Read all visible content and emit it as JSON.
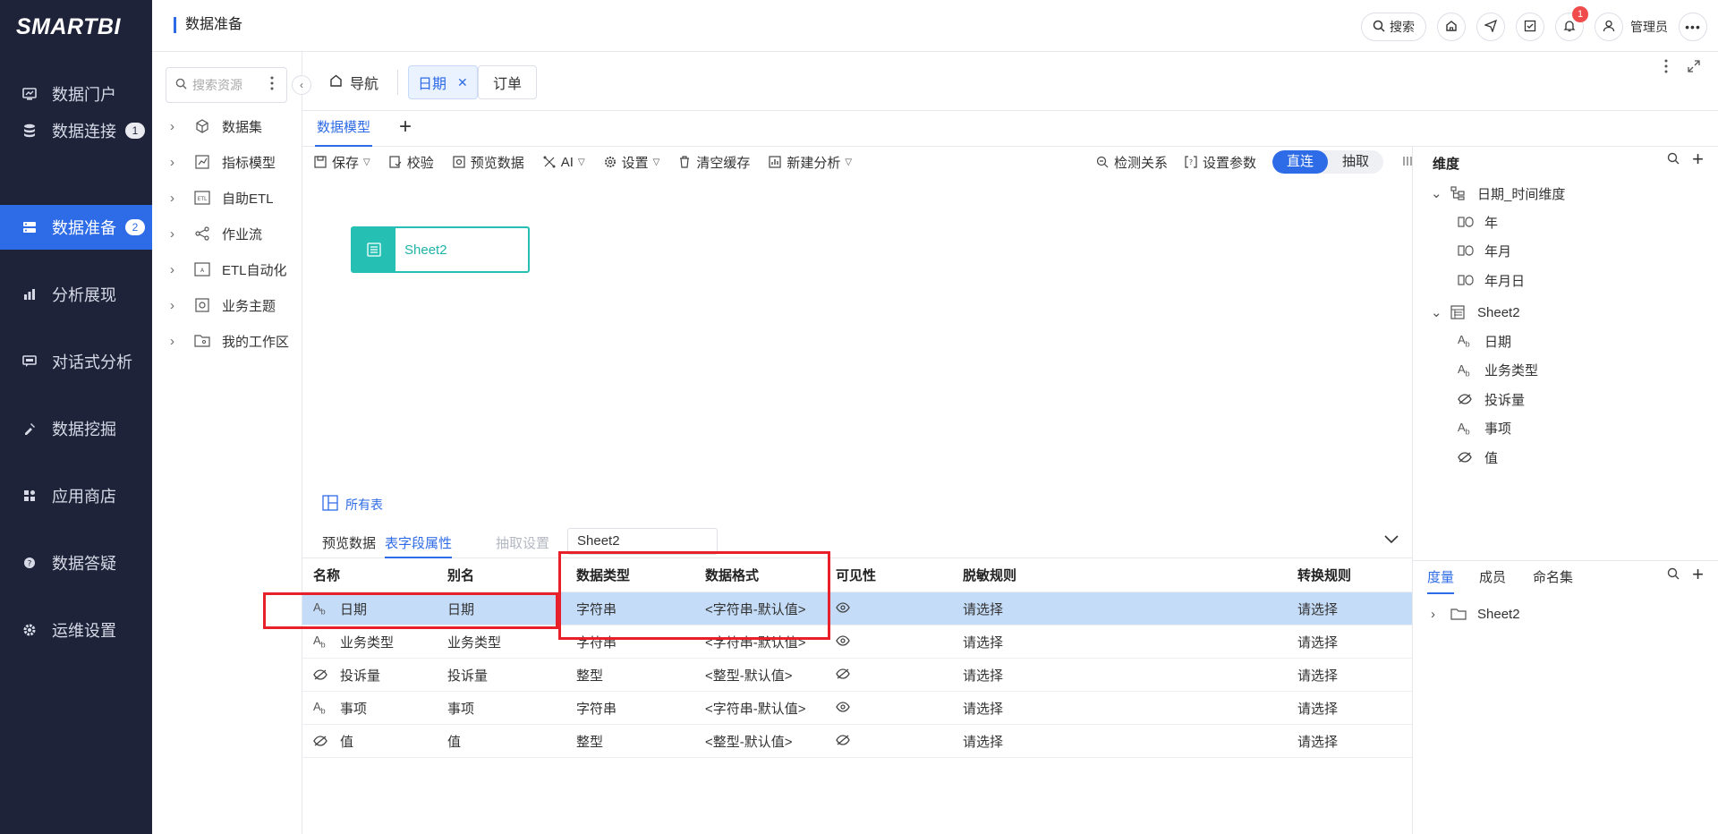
{
  "brand": "SMARTBI",
  "nav": [
    {
      "label": "数据门户",
      "icon": "portal-icon",
      "badge": ""
    },
    {
      "label": "数据连接",
      "icon": "database-icon",
      "badge": "1"
    },
    {
      "label": "数据准备",
      "icon": "server-icon",
      "badge": "2",
      "active": true
    },
    {
      "label": "分析展现",
      "icon": "bar-chart-icon",
      "badge": ""
    },
    {
      "label": "对话式分析",
      "icon": "chat-icon",
      "badge": ""
    },
    {
      "label": "数据挖掘",
      "icon": "pick-icon",
      "badge": ""
    },
    {
      "label": "应用商店",
      "icon": "apps-icon",
      "badge": ""
    },
    {
      "label": "数据答疑",
      "icon": "help-icon",
      "badge": ""
    },
    {
      "label": "运维设置",
      "icon": "gear-icon",
      "badge": ""
    }
  ],
  "header": {
    "title": "数据准备",
    "search": "搜索",
    "notif_count": "1",
    "user": "管理员"
  },
  "resources": {
    "search_placeholder": "搜索资源",
    "items": [
      "数据集",
      "指标模型",
      "自助ETL",
      "作业流",
      "ETL自动化",
      "业务主题",
      "我的工作区"
    ]
  },
  "tabs": {
    "nav": "导航",
    "items": [
      {
        "label": "日期",
        "active": true
      },
      {
        "label": "订单",
        "active": false
      }
    ]
  },
  "subtab": "数据模型",
  "toolbar": {
    "save": "保存",
    "validate": "校验",
    "preview": "预览数据",
    "ai": "AI",
    "settings": "设置",
    "clear_cache": "清空缓存",
    "new_analysis": "新建分析",
    "detect": "检测关系",
    "params": "设置参数",
    "mode_direct": "直连",
    "mode_extract": "抽取"
  },
  "canvas": {
    "node_label": "Sheet2",
    "all_tables": "所有表"
  },
  "bottom": {
    "tabs": [
      "预览数据",
      "表字段属性",
      "抽取设置"
    ],
    "sheet": "Sheet2",
    "columns": {
      "name": "名称",
      "alias": "别名",
      "type": "数据类型",
      "format": "数据格式",
      "visibility": "可见性",
      "mask": "脱敏规则",
      "convert": "转换规则"
    },
    "rows": [
      {
        "icon": "Ab",
        "name": "日期",
        "alias": "日期",
        "type": "字符串",
        "format": "<字符串-默认值>",
        "mask": "请选择",
        "convert": "请选择",
        "visible": true
      },
      {
        "icon": "Ab",
        "name": "业务类型",
        "alias": "业务类型",
        "type": "字符串",
        "format": "<字符串-默认值>",
        "mask": "请选择",
        "convert": "请选择",
        "visible": true
      },
      {
        "icon": "hidden",
        "name": "投诉量",
        "alias": "投诉量",
        "type": "整型",
        "format": "<整型-默认值>",
        "mask": "请选择",
        "convert": "请选择",
        "visible": false
      },
      {
        "icon": "Ab",
        "name": "事项",
        "alias": "事项",
        "type": "字符串",
        "format": "<字符串-默认值>",
        "mask": "请选择",
        "convert": "请选择",
        "visible": true
      },
      {
        "icon": "hidden",
        "name": "值",
        "alias": "值",
        "type": "整型",
        "format": "<整型-默认值>",
        "mask": "请选择",
        "convert": "请选择",
        "visible": false
      }
    ]
  },
  "right": {
    "title": "维度",
    "date_dim": "日期_时间维度",
    "date_levels": [
      "年",
      "年月",
      "年月日"
    ],
    "sheet": "Sheet2",
    "fields": [
      {
        "icon": "Ab",
        "label": "日期"
      },
      {
        "icon": "Ab",
        "label": "业务类型"
      },
      {
        "icon": "hidden",
        "label": "投诉量"
      },
      {
        "icon": "Ab",
        "label": "事项"
      },
      {
        "icon": "hidden",
        "label": "值"
      }
    ],
    "tabs": [
      "度量",
      "成员",
      "命名集"
    ],
    "measure_folder": "Sheet2"
  }
}
